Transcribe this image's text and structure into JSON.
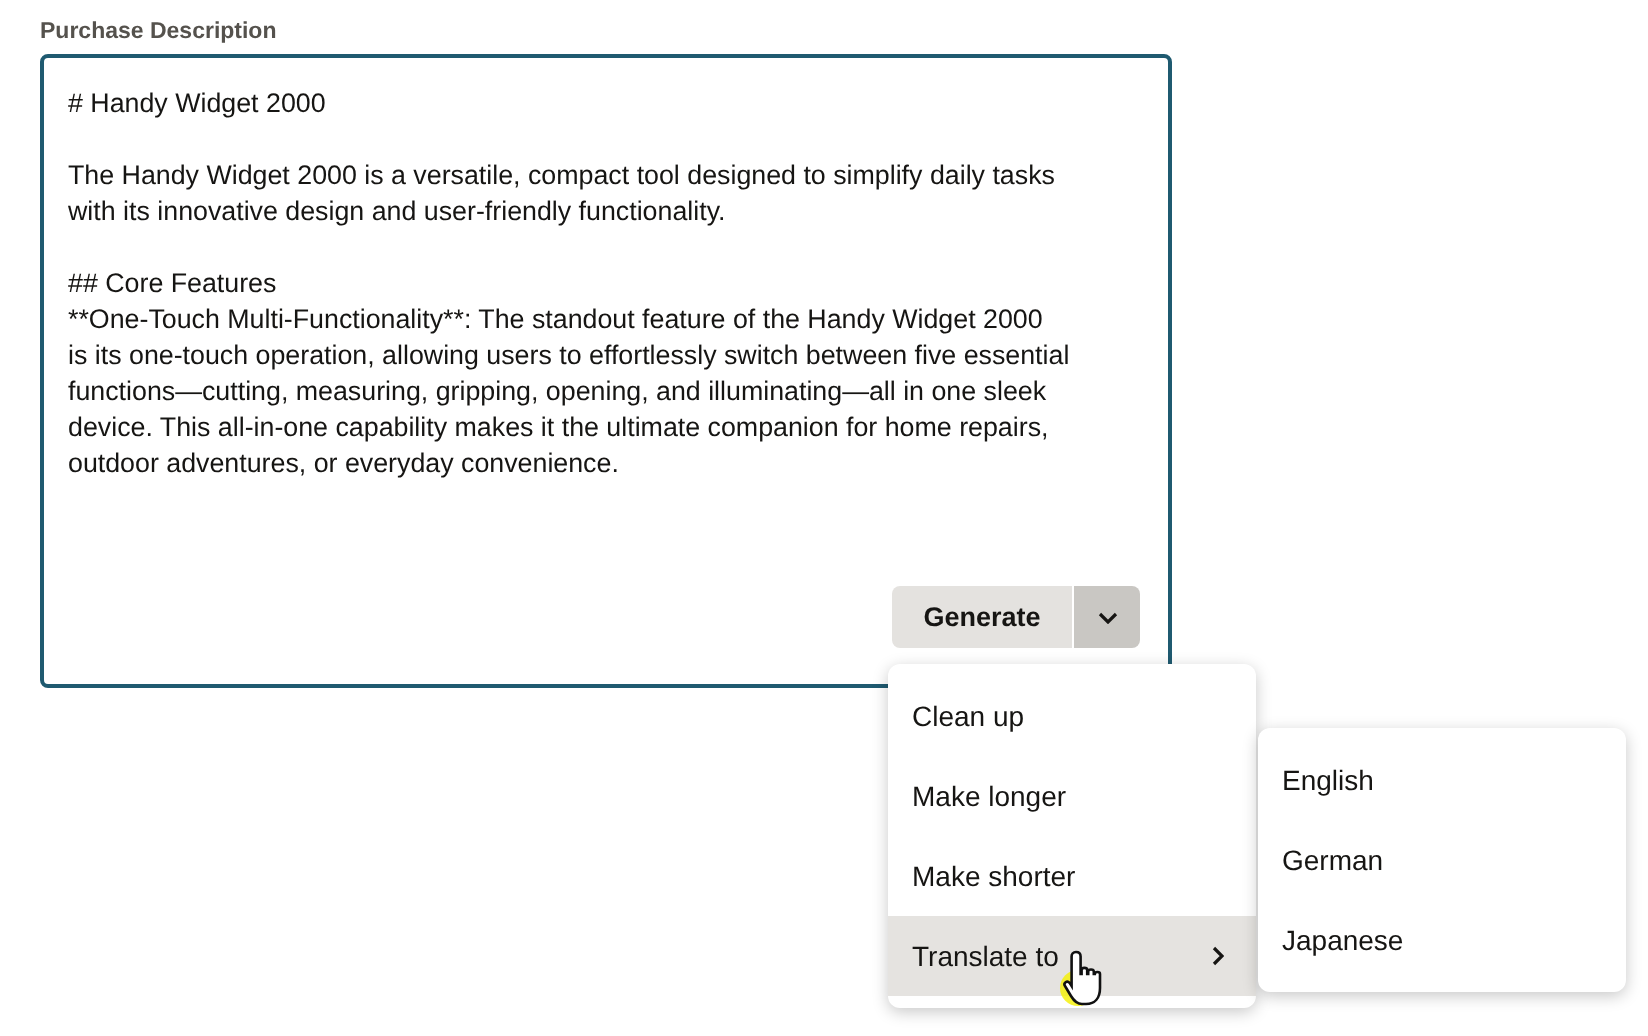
{
  "field": {
    "label": "Purchase Description",
    "paragraphs": [
      [
        "# Handy Widget 2000"
      ],
      [
        "The Handy Widget 2000 is a versatile, compact tool designed to simplify daily tasks",
        "with its innovative design and user-friendly functionality."
      ],
      [
        "## Core Features",
        "**One-Touch Multi-Functionality**: The standout feature of the Handy Widget 2000",
        "is its one-touch operation, allowing users to effortlessly switch between five essential",
        "functions—cutting, measuring, gripping, opening, and illuminating—all in one sleek",
        "device. This all-in-one capability makes it the ultimate companion for home repairs,",
        "outdoor adventures, or everyday convenience."
      ]
    ]
  },
  "generate_button": {
    "label": "Generate"
  },
  "menu": {
    "items": [
      {
        "label": "Clean up",
        "selected": false,
        "submenu": false
      },
      {
        "label": "Make longer",
        "selected": false,
        "submenu": false
      },
      {
        "label": "Make shorter",
        "selected": false,
        "submenu": false
      },
      {
        "label": "Translate to",
        "selected": true,
        "submenu": true
      }
    ]
  },
  "submenu": {
    "items": [
      {
        "label": "English"
      },
      {
        "label": "German"
      },
      {
        "label": "Japanese"
      }
    ]
  }
}
